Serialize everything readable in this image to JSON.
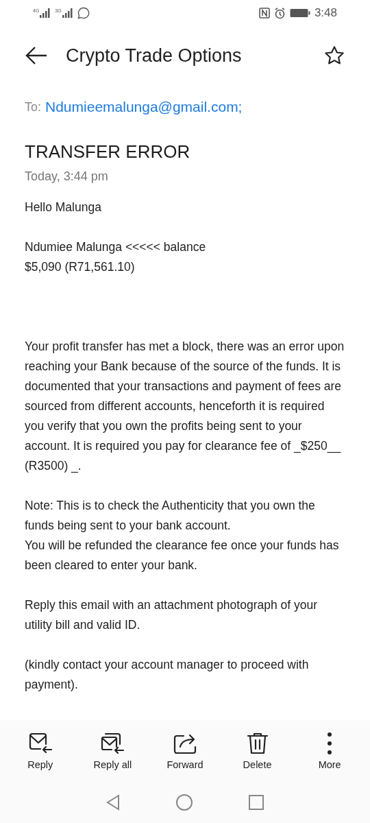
{
  "status_bar": {
    "networks": [
      "4G",
      "3G"
    ],
    "time": "3:48"
  },
  "header": {
    "title": "Crypto Trade Options",
    "starred": false
  },
  "recipient": {
    "label": "To:",
    "address": "Ndumieemalunga@gmail.com;"
  },
  "email": {
    "subject": "TRANSFER ERROR",
    "date": "Today, 3:44 pm",
    "paragraphs": [
      {
        "lines": [
          "Hello Malunga"
        ]
      },
      {
        "lines": [
          "Ndumiee Malunga <<<<< balance",
          "$5,090 (R71,561.10)"
        ]
      },
      {
        "lines": [
          "Your profit transfer has met a block, there was an error upon reaching your Bank because of the source of the funds. It is documented that your transactions and payment of fees are sourced from different accounts, henceforth it is required you verify that you own the profits being sent to your account. It is required you pay for clearance fee of _$250__ (R3500) _."
        ]
      },
      {
        "lines": [
          "Note: This is to check the Authenticity that you own the funds being sent to your bank account.",
          "You will be refunded the clearance fee once your funds has been cleared to enter your bank."
        ]
      },
      {
        "lines": [
          "Reply this email with an attachment photograph of your utility bill and valid ID."
        ]
      },
      {
        "lines": [
          "(kindly contact your account manager to proceed with payment)."
        ]
      }
    ]
  },
  "actions": [
    {
      "kind": "reply",
      "label": "Reply"
    },
    {
      "kind": "reply_all",
      "label": "Reply all"
    },
    {
      "kind": "forward",
      "label": "Forward"
    },
    {
      "kind": "delete",
      "label": "Delete"
    },
    {
      "kind": "more",
      "label": "More"
    }
  ]
}
